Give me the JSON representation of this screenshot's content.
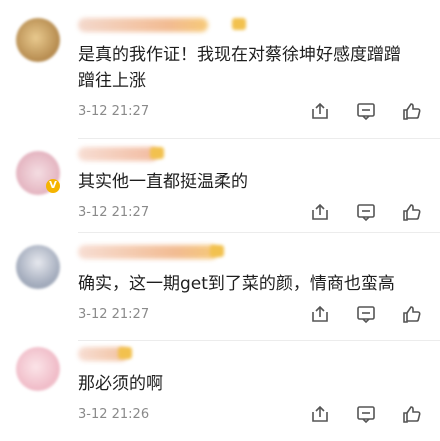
{
  "comments": [
    {
      "text_lines": [
        "是真的我作证！我现在对蔡徐坤好感度蹭蹭",
        "蹭往上涨"
      ],
      "time": "3-12 21:27",
      "avatar_color": "#caa46a",
      "username_color": "#e9a98a"
    },
    {
      "text_lines": [
        "其实他一直都挺温柔的"
      ],
      "time": "3-12 21:27",
      "avatar_color": "#e8c4cc",
      "username_color": "#f0b8a8",
      "verified_icon": "V"
    },
    {
      "text_lines": [
        "确实，这一期get到了菜的颜，情商也蛮高"
      ],
      "time": "3-12 21:27",
      "avatar_color": "#9aa6b8",
      "username_color": "#f0b08a"
    },
    {
      "text_lines": [
        "那必须的啊"
      ],
      "time": "3-12 21:26",
      "avatar_color": "#f0c4cc",
      "username_color": "#f0b890"
    }
  ],
  "icons": {
    "share": "share-icon",
    "reply": "comment-icon",
    "like": "thumbs-up-icon"
  }
}
